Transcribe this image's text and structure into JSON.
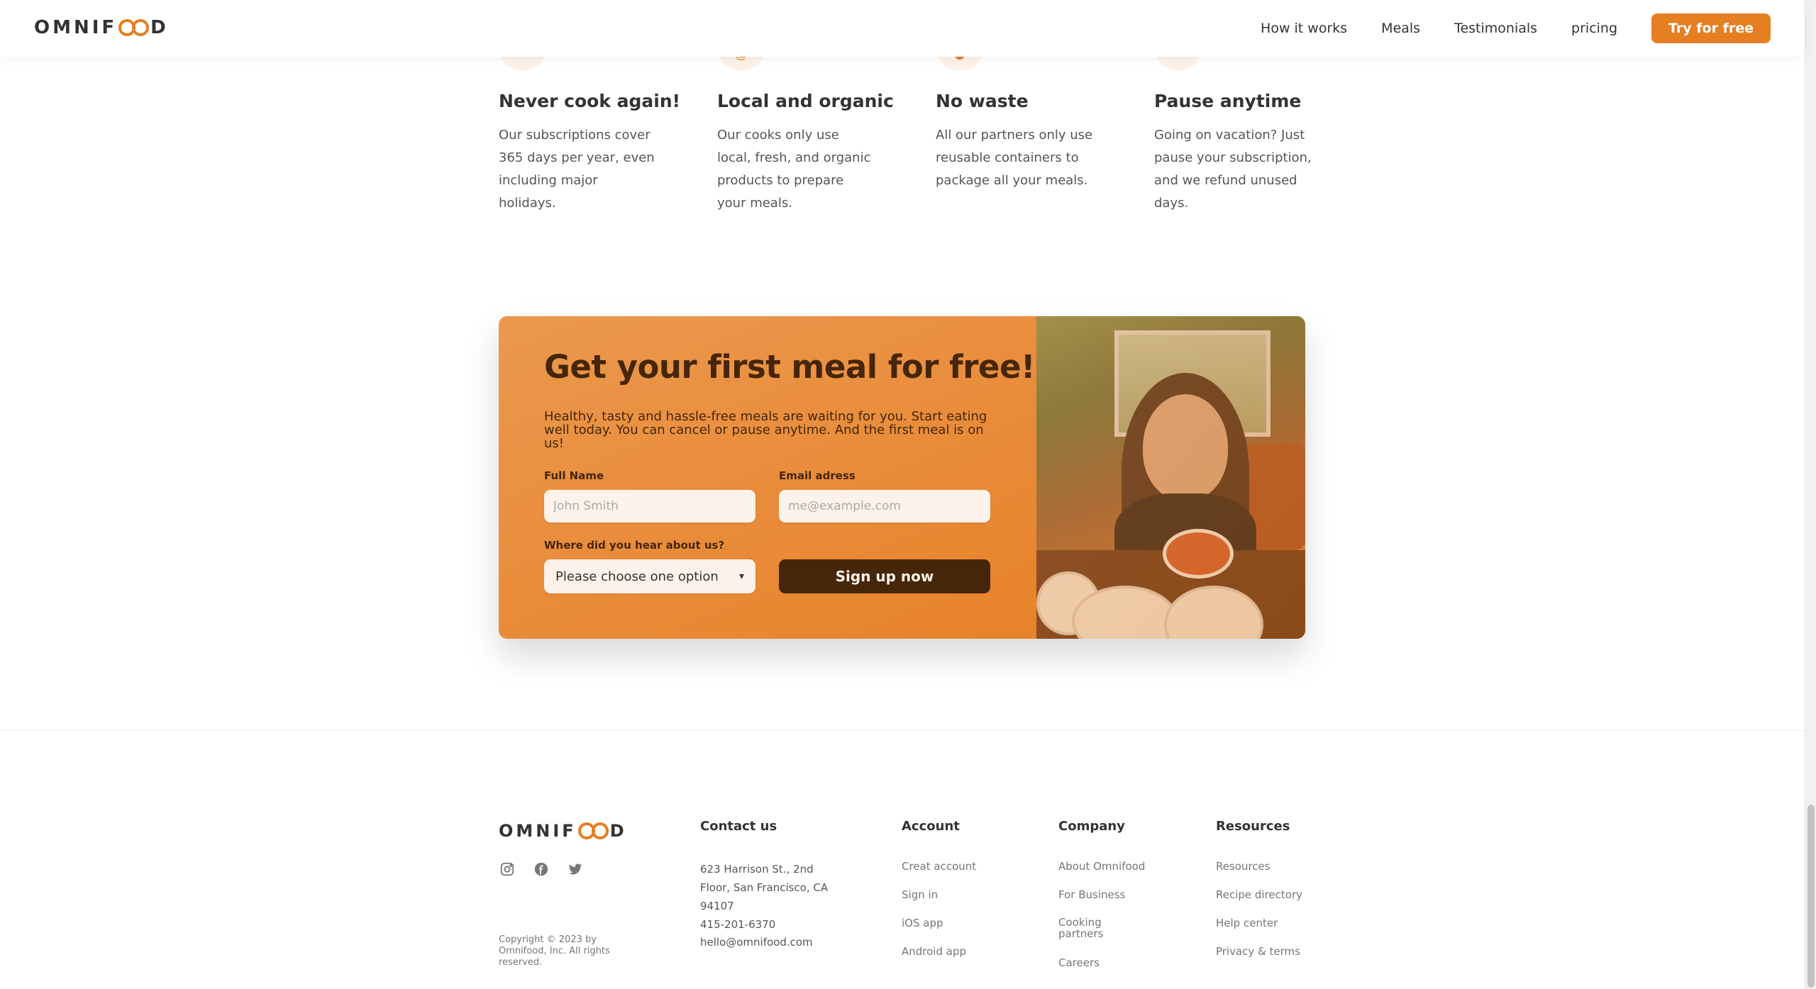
{
  "header": {
    "logo_left": "OMNIF",
    "logo_right": "D",
    "nav": [
      "How it works",
      "Meals",
      "Testimonials",
      "pricing"
    ],
    "cta": "Try for free"
  },
  "features": [
    {
      "title": "Never cook again!",
      "text": "Our subscriptions cover 365 days per year, even including major holidays."
    },
    {
      "title": "Local and organic",
      "text": "Our cooks only use local, fresh, and organic products to prepare your meals."
    },
    {
      "title": "No waste",
      "text": "All our partners only use reusable containers to package all your meals."
    },
    {
      "title": "Pause anytime",
      "text": "Going on vacation? Just pause your subscription, and we refund unused days."
    }
  ],
  "cta": {
    "title": "Get your first meal for free!",
    "subtitle": "Healthy, tasty and hassle-free meals are waiting for you. Start eating well today. You can cancel or pause anytime. And the first meal is on us!",
    "full_name_label": "Full Name",
    "full_name_placeholder": "John Smith",
    "email_label": "Email adress",
    "email_placeholder": "me@example.com",
    "source_label": "Where did you hear about us?",
    "source_selected": "Please choose one option",
    "submit": "Sign up now"
  },
  "footer": {
    "logo_left": "OMNIF",
    "logo_right": "D",
    "copyright": "Copyright © 2023 by Omnifood, Inc. All rights reserved.",
    "contact": {
      "heading": "Contact us",
      "address": "623 Harrison St., 2nd Floor, San Francisco, CA 94107",
      "phone": "415-201-6370",
      "email": "hello@omnifood.com"
    },
    "account": {
      "heading": "Account",
      "links": [
        "Creat account",
        "Sign in",
        "iOS app",
        "Android app"
      ]
    },
    "company": {
      "heading": "Company",
      "links": [
        "About Omnifood",
        "For Business",
        "Cooking partners",
        "Careers"
      ]
    },
    "resources": {
      "heading": "Resources",
      "links": [
        "Resources",
        "Recipe directory",
        "Help center",
        "Privacy & terms"
      ]
    }
  },
  "colors": {
    "accent": "#e67e22",
    "cta_dark": "#45260a",
    "tint": "#fdf2e9"
  },
  "icons": [
    "instagram-icon",
    "facebook-icon",
    "twitter-icon"
  ]
}
